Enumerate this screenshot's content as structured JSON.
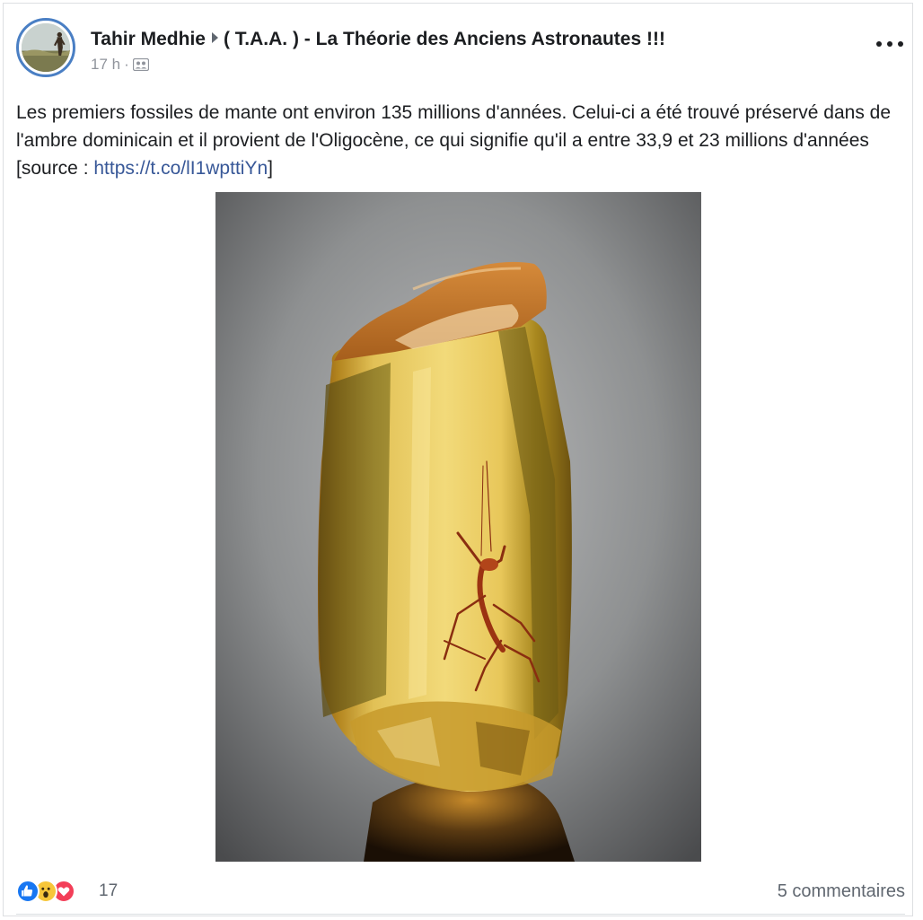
{
  "post": {
    "author": "Tahir Medhie",
    "group": "( T.A.A. ) - La Théorie des Anciens Astronautes !!!",
    "time": "17 h",
    "separator": "·",
    "audience_icon": "group-members-icon",
    "more_icon": "more-options-icon",
    "text_part1": "Les premiers fossiles de mante ont environ 135 millions d'années. Celui-ci a été trouvé préservé dans de l'ambre dominicain et il provient de l'Oligocène, ce qui signifie qu'il a entre 33,9 et 23 millions d'années [source : ",
    "text_link": "https://t.co/lI1wpttiYn",
    "text_part2": "]",
    "link_color": "#385898"
  },
  "footer": {
    "reaction_icons": [
      "like-icon",
      "wow-icon",
      "love-icon"
    ],
    "reaction_count": "17",
    "comments": "5 commentaires"
  }
}
